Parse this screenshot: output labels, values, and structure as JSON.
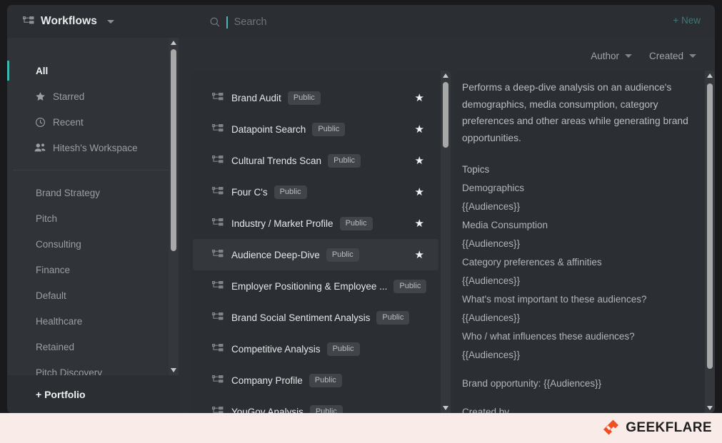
{
  "header": {
    "app_icon": "workflow-nodes-icon",
    "title": "Workflows",
    "dropdown_icon": "chevron-down-icon",
    "search": {
      "icon": "search-icon",
      "placeholder": "Search",
      "value": ""
    },
    "new_button": "+ New",
    "accent_color": "#3fb6ac",
    "new_button_color": "#3c7a77"
  },
  "filters": [
    {
      "label": "Author",
      "icon": "chevron-down-icon"
    },
    {
      "label": "Created",
      "icon": "chevron-down-icon"
    }
  ],
  "sidebar": {
    "nav": [
      {
        "label": "All",
        "icon": null,
        "active": true
      },
      {
        "label": "Starred",
        "icon": "star-icon",
        "active": false
      },
      {
        "label": "Recent",
        "icon": "clock-icon",
        "active": false
      },
      {
        "label": "Hitesh's Workspace",
        "icon": "people-icon",
        "active": false
      }
    ],
    "folders": [
      {
        "label": "Brand Strategy"
      },
      {
        "label": "Pitch"
      },
      {
        "label": "Consulting"
      },
      {
        "label": "Finance"
      },
      {
        "label": "Default"
      },
      {
        "label": "Healthcare"
      },
      {
        "label": "Retained"
      },
      {
        "label": "Pitch Discovery"
      }
    ],
    "footer_button": "+ Portfolio",
    "scrollbar": {
      "up_icon": "triangle-up-icon",
      "down_icon": "triangle-down-icon"
    }
  },
  "workflow_list": {
    "item_icon": "workflow-nodes-icon",
    "star_icon": "star-icon",
    "items": [
      {
        "name": "Brand Audit",
        "badge": "Public",
        "starred": true,
        "selected": false
      },
      {
        "name": "Datapoint Search",
        "badge": "Public",
        "starred": true,
        "selected": false
      },
      {
        "name": "Cultural Trends Scan",
        "badge": "Public",
        "starred": true,
        "selected": false
      },
      {
        "name": "Four C's",
        "badge": "Public",
        "starred": true,
        "selected": false
      },
      {
        "name": "Industry / Market Profile",
        "badge": "Public",
        "starred": true,
        "selected": false
      },
      {
        "name": "Audience Deep-Dive",
        "badge": "Public",
        "starred": true,
        "selected": true
      },
      {
        "name": "Employer Positioning & Employee ...",
        "badge": "Public",
        "starred": false,
        "selected": false
      },
      {
        "name": "Brand Social Sentiment Analysis",
        "badge": "Public",
        "starred": false,
        "selected": false
      },
      {
        "name": "Competitive Analysis",
        "badge": "Public",
        "starred": false,
        "selected": false
      },
      {
        "name": "Company Profile",
        "badge": "Public",
        "starred": false,
        "selected": false
      },
      {
        "name": "YouGov Analysis",
        "badge": "Public",
        "starred": false,
        "selected": false
      }
    ]
  },
  "detail": {
    "description": "Performs a deep-dive analysis on an audience's demographics, media consumption, category preferences and other areas while generating brand opportunities.",
    "topics_heading": "Topics",
    "topics": [
      "Demographics",
      "{{Audiences}}",
      "Media Consumption",
      "{{Audiences}}",
      "Category preferences & affinities",
      "{{Audiences}}",
      "What's most important to these audiences?",
      "{{Audiences}}",
      "Who / what influences these audiences?",
      "{{Audiences}}"
    ],
    "brand_opportunity": "Brand opportunity: {{Audiences}}",
    "created_by_partial": "Created by"
  },
  "watermark": {
    "text": "GEEKFLARE",
    "logo_color": "#f04e23",
    "text_color": "#1f1f1f"
  }
}
